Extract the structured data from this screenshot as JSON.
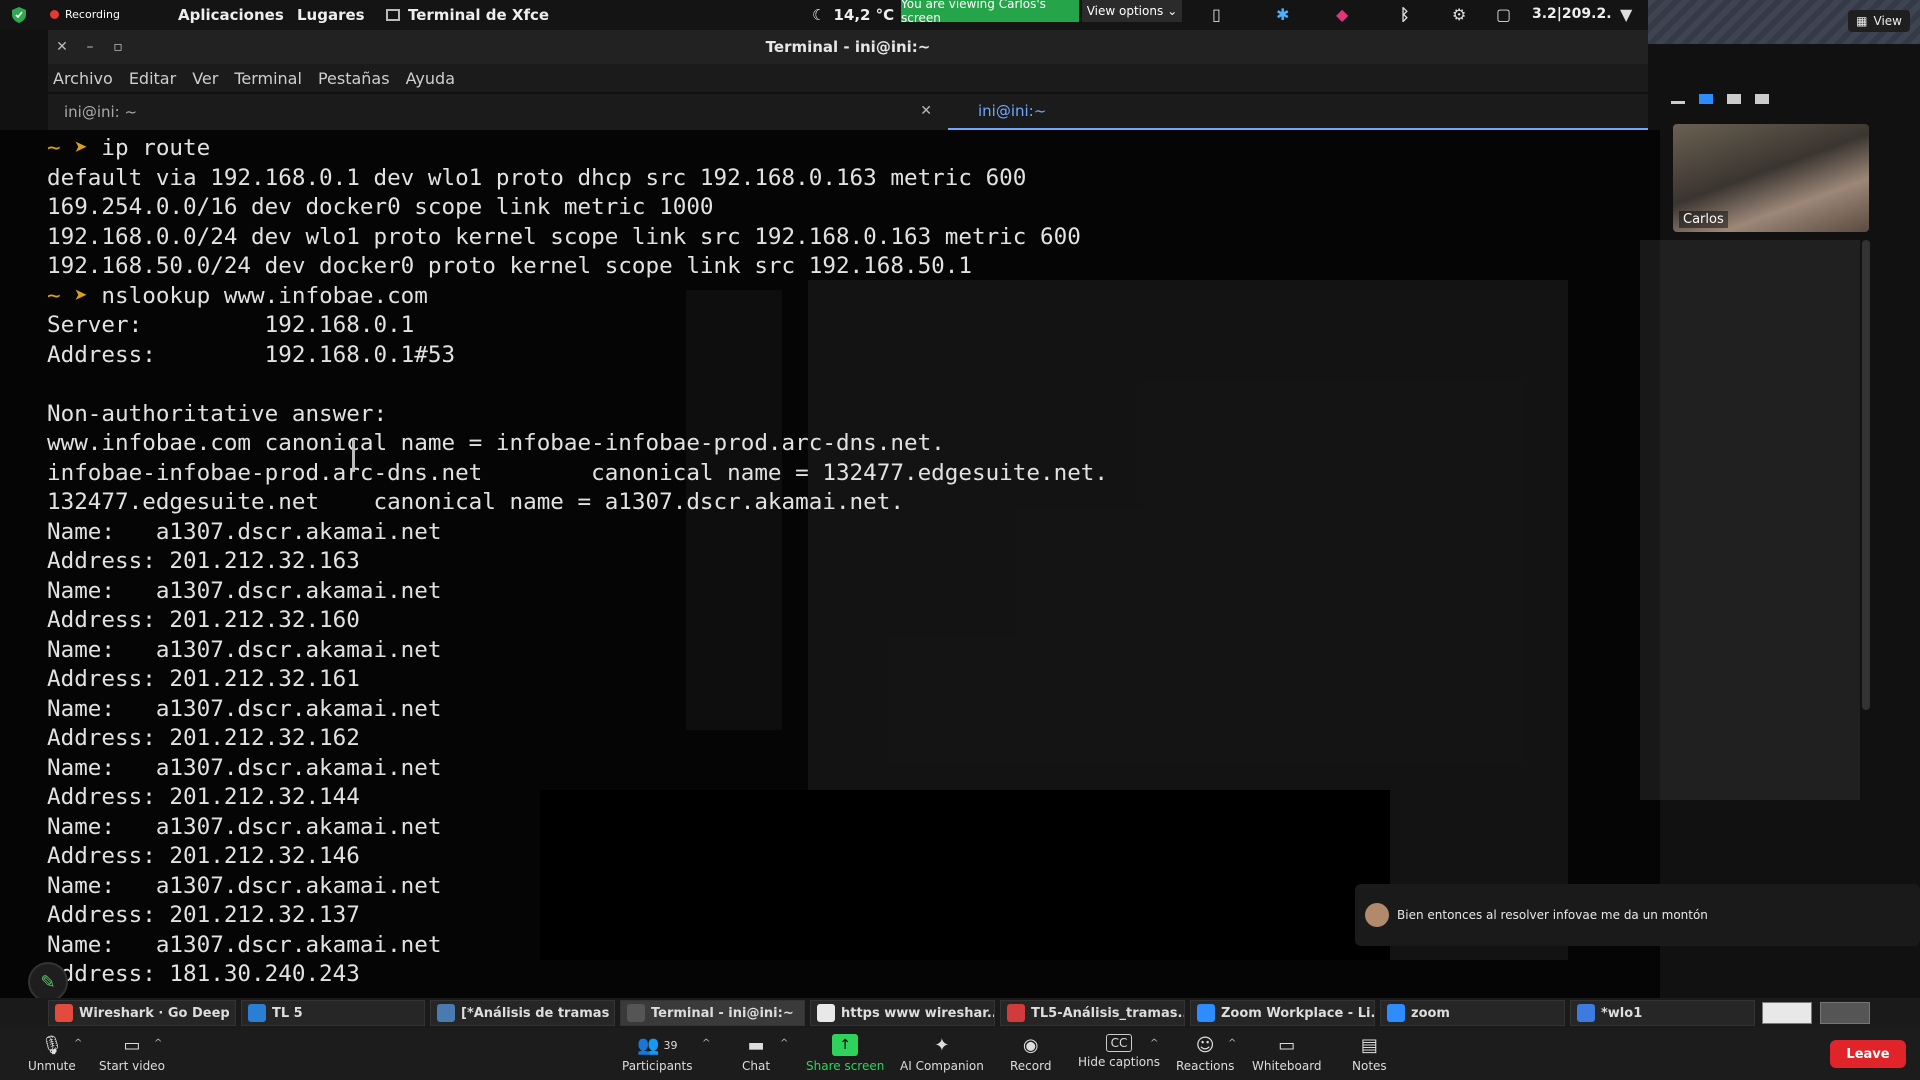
{
  "top_panel": {
    "recording_label": "Recording",
    "apps_menu": "Aplicaciones",
    "places_menu": "Lugares",
    "active_window": "Terminal de Xfce",
    "temperature": "14,2 °C",
    "viewing_banner": "You are viewing Carlos's screen",
    "view_options": "View options",
    "net_stats": "3.2|209.2."
  },
  "zoom": {
    "view_button": "View",
    "participant_name": "Carlos",
    "chat_toast": "Bien entonces al resolver infovae me da un montón"
  },
  "terminal": {
    "title": "Terminal - ini@ini:~",
    "menu": [
      "Archivo",
      "Editar",
      "Ver",
      "Terminal",
      "Pestañas",
      "Ayuda"
    ],
    "tabs": [
      {
        "label": "ini@ini: ~",
        "active": false
      },
      {
        "label": "ini@ini:~",
        "active": true
      }
    ],
    "prompt_symbol": "~ ➤",
    "lines": [
      {
        "prompt": true,
        "text": "ip route"
      },
      {
        "prompt": false,
        "text": "default via 192.168.0.1 dev wlo1 proto dhcp src 192.168.0.163 metric 600"
      },
      {
        "prompt": false,
        "text": "169.254.0.0/16 dev docker0 scope link metric 1000"
      },
      {
        "prompt": false,
        "text": "192.168.0.0/24 dev wlo1 proto kernel scope link src 192.168.0.163 metric 600"
      },
      {
        "prompt": false,
        "text": "192.168.50.0/24 dev docker0 proto kernel scope link src 192.168.50.1"
      },
      {
        "prompt": true,
        "text": "nslookup www.infobae.com"
      },
      {
        "prompt": false,
        "text": "Server:         192.168.0.1"
      },
      {
        "prompt": false,
        "text": "Address:        192.168.0.1#53"
      },
      {
        "prompt": false,
        "text": ""
      },
      {
        "prompt": false,
        "text": "Non-authoritative answer:"
      },
      {
        "prompt": false,
        "text": "www.infobae.com canonical name = infobae-infobae-prod.arc-dns.net."
      },
      {
        "prompt": false,
        "text": "infobae-infobae-prod.arc-dns.net        canonical name = 132477.edgesuite.net."
      },
      {
        "prompt": false,
        "text": "132477.edgesuite.net    canonical name = a1307.dscr.akamai.net."
      },
      {
        "prompt": false,
        "text": "Name:   a1307.dscr.akamai.net"
      },
      {
        "prompt": false,
        "text": "Address: 201.212.32.163"
      },
      {
        "prompt": false,
        "text": "Name:   a1307.dscr.akamai.net"
      },
      {
        "prompt": false,
        "text": "Address: 201.212.32.160"
      },
      {
        "prompt": false,
        "text": "Name:   a1307.dscr.akamai.net"
      },
      {
        "prompt": false,
        "text": "Address: 201.212.32.161"
      },
      {
        "prompt": false,
        "text": "Name:   a1307.dscr.akamai.net"
      },
      {
        "prompt": false,
        "text": "Address: 201.212.32.162"
      },
      {
        "prompt": false,
        "text": "Name:   a1307.dscr.akamai.net"
      },
      {
        "prompt": false,
        "text": "Address: 201.212.32.144"
      },
      {
        "prompt": false,
        "text": "Name:   a1307.dscr.akamai.net"
      },
      {
        "prompt": false,
        "text": "Address: 201.212.32.146"
      },
      {
        "prompt": false,
        "text": "Name:   a1307.dscr.akamai.net"
      },
      {
        "prompt": false,
        "text": "Address: 201.212.32.137"
      },
      {
        "prompt": false,
        "text": "Name:   a1307.dscr.akamai.net"
      },
      {
        "prompt": false,
        "text": "Address: 181.30.240.243"
      }
    ]
  },
  "taskbar": {
    "tasks": [
      {
        "label": "Wireshark · Go Deep ...",
        "icon_color": "#e34c3c",
        "active": false
      },
      {
        "label": "TL 5",
        "icon_color": "#2a7fd4",
        "active": false
      },
      {
        "label": "[*Análisis de tramas ...",
        "icon_color": "#4a7bb0",
        "active": false
      },
      {
        "label": "Terminal - ini@ini:~",
        "icon_color": "#555555",
        "active": true
      },
      {
        "label": "https www wireshar...",
        "icon_color": "#e8e8e8",
        "active": false
      },
      {
        "label": "TL5-Análisis_tramas...",
        "icon_color": "#d23b3b",
        "active": false
      },
      {
        "label": "Zoom Workplace - Li...",
        "icon_color": "#2d8cff",
        "active": false
      },
      {
        "label": "zoom",
        "icon_color": "#2d8cff",
        "active": false
      },
      {
        "label": "*wlo1",
        "icon_color": "#3d7be0",
        "active": false
      }
    ]
  },
  "zoom_bar": {
    "unmute": "Unmute",
    "start_video": "Start video",
    "participants": "Participants",
    "participant_count": "39",
    "chat": "Chat",
    "share_screen": "Share screen",
    "ai_companion": "AI Companion",
    "record": "Record",
    "hide_captions": "Hide captions",
    "reactions": "Reactions",
    "whiteboard": "Whiteboard",
    "notes": "Notes",
    "leave": "Leave"
  }
}
